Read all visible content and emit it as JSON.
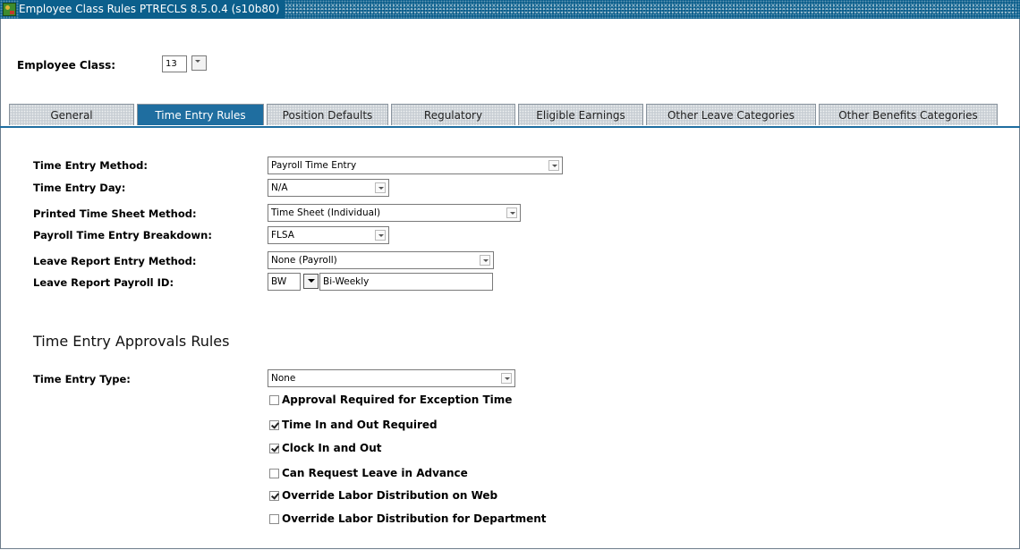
{
  "window": {
    "title": "Employee Class Rules  PTRECLS  8.5.0.4  (s10b80)"
  },
  "key_block": {
    "label": "Employee Class:",
    "value": "13"
  },
  "tabs": [
    {
      "label": "General",
      "active": false
    },
    {
      "label": "Time Entry Rules",
      "active": true
    },
    {
      "label": "Position Defaults",
      "active": false
    },
    {
      "label": "Regulatory",
      "active": false
    },
    {
      "label": "Eligible Earnings",
      "active": false
    },
    {
      "label": "Other Leave Categories",
      "active": false
    },
    {
      "label": "Other Benefits Categories",
      "active": false
    }
  ],
  "time_entry": {
    "method_label": "Time Entry Method:",
    "method_value": "Payroll Time Entry",
    "day_label": "Time Entry Day:",
    "day_value": "N/A",
    "printed_label": "Printed Time Sheet Method:",
    "printed_value": "Time Sheet (Individual)",
    "breakdown_label": "Payroll Time Entry Breakdown:",
    "breakdown_value": "FLSA",
    "leave_method_label": "Leave Report Entry Method:",
    "leave_method_value": "None (Payroll)",
    "leave_payroll_label": "Leave Report Payroll ID:",
    "leave_payroll_code": "BW",
    "leave_payroll_desc": "Bi-Weekly"
  },
  "approvals": {
    "section_title": "Time Entry Approvals Rules",
    "type_label": "Time Entry Type:",
    "type_value": "None",
    "checkboxes": [
      {
        "label": "Approval Required for Exception Time",
        "checked": false
      },
      {
        "label": "Time In and Out Required",
        "checked": true
      },
      {
        "label": "Clock In and Out",
        "checked": true
      },
      {
        "label": "Can Request Leave in Advance",
        "checked": false
      },
      {
        "label": "Override Labor Distribution on Web",
        "checked": true
      },
      {
        "label": "Override Labor Distribution for Department",
        "checked": false
      }
    ]
  }
}
